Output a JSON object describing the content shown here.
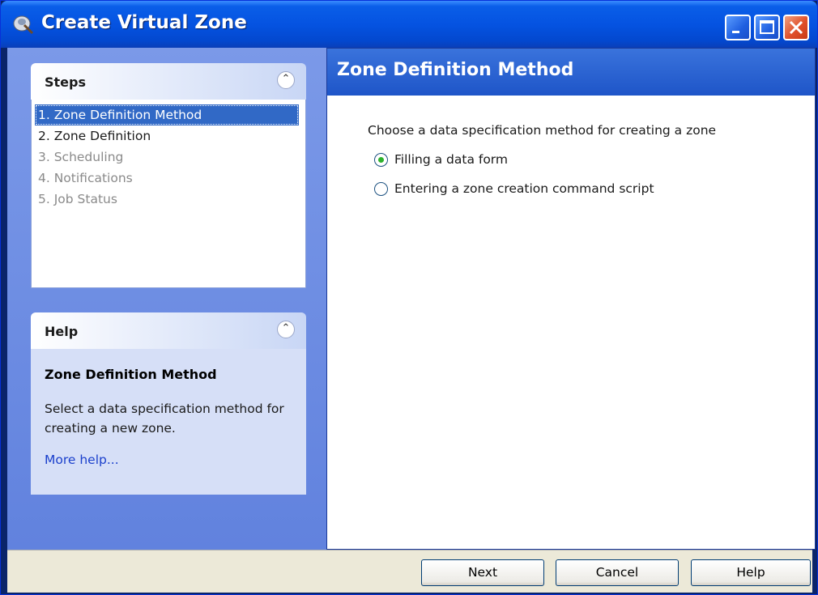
{
  "window": {
    "title": "Create Virtual Zone"
  },
  "steps_panel": {
    "label": "Steps",
    "items": [
      {
        "label": "1. Zone Definition Method",
        "state": "active"
      },
      {
        "label": "2. Zone Definition",
        "state": "enabled"
      },
      {
        "label": "3. Scheduling",
        "state": "disabled"
      },
      {
        "label": "4. Notifications",
        "state": "disabled"
      },
      {
        "label": "5. Job Status",
        "state": "disabled"
      }
    ]
  },
  "help_panel": {
    "label": "Help",
    "title": "Zone Definition Method",
    "text": "Select a data specification method for creating a new zone.",
    "link": "More help..."
  },
  "content": {
    "header": "Zone Definition Method",
    "prompt": "Choose a data specification method for creating a zone",
    "options": [
      {
        "label": "Filling a data form",
        "selected": true
      },
      {
        "label": "Entering a zone creation command script",
        "selected": false
      }
    ]
  },
  "footer": {
    "next_label": "Next",
    "cancel_label": "Cancel",
    "help_label": "Help"
  },
  "icons": {
    "title_icon": "zone-wizard-icon",
    "collapse_icon": "chevron-double-up-icon"
  },
  "colors": {
    "accent": "#0553e1",
    "selection": "#3169c6",
    "radio_selected": "#2db22d"
  }
}
